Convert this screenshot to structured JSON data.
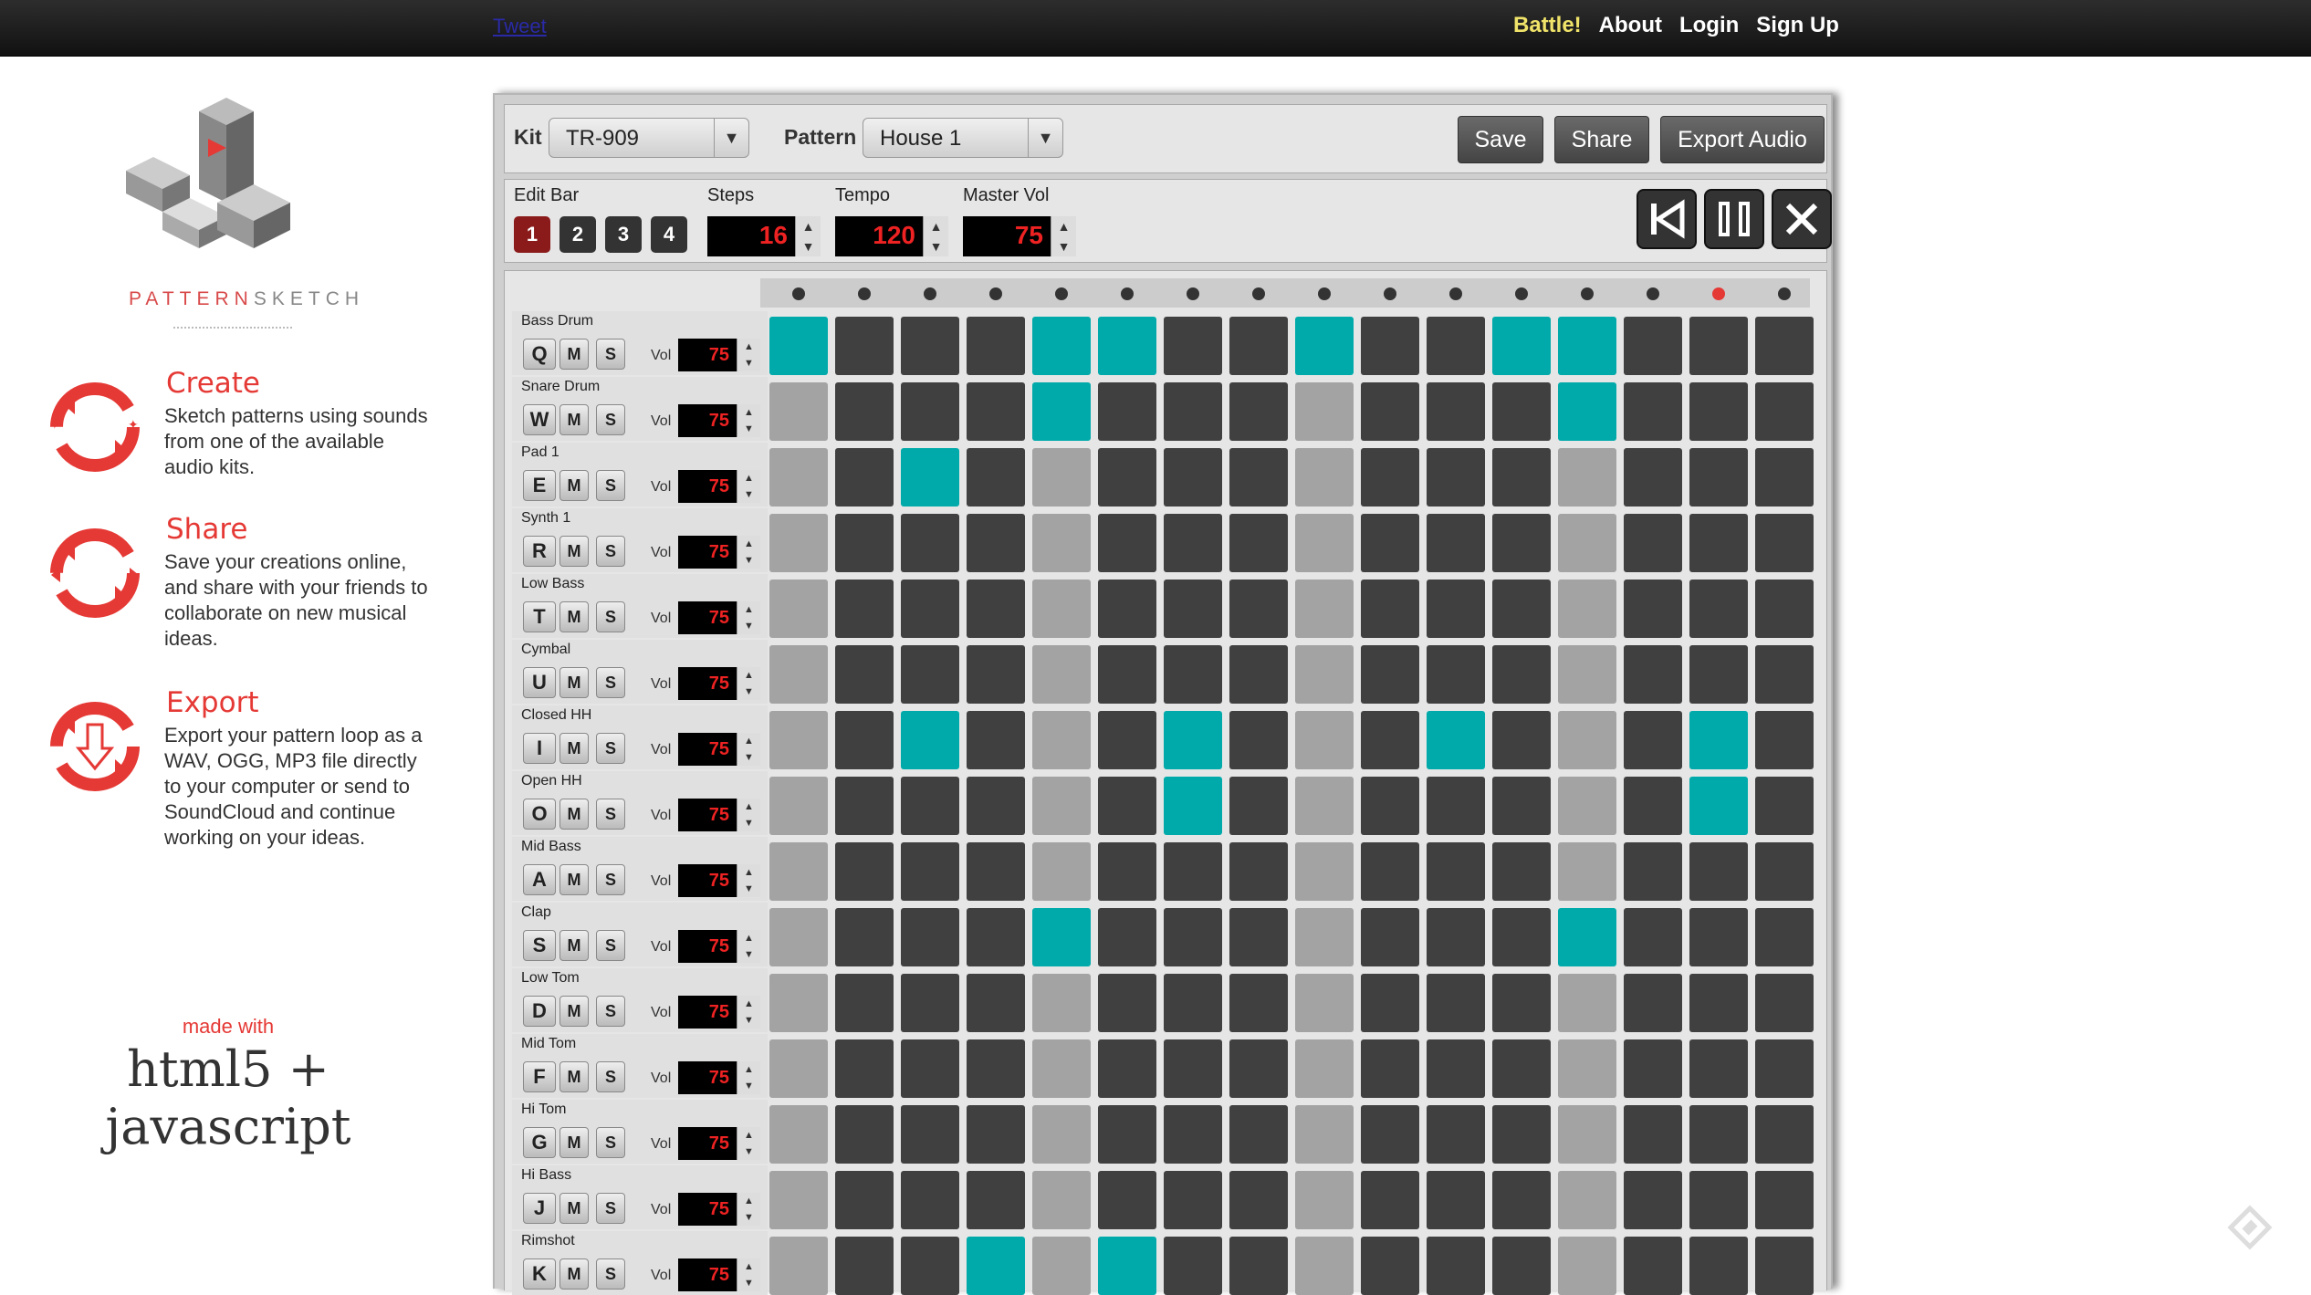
{
  "topbar": {
    "tweet": "Tweet",
    "nav": [
      {
        "label": "Battle!",
        "highlight": true
      },
      {
        "label": "About"
      },
      {
        "label": "Login"
      },
      {
        "label": "Sign Up"
      }
    ]
  },
  "brand": {
    "part1": "PATTERN",
    "part2": "SKETCH"
  },
  "features": [
    {
      "title": "Create",
      "text": "Sketch patterns using sounds from one of the available audio kits."
    },
    {
      "title": "Share",
      "text": "Save your creations online, and share with your friends to collaborate on new musical ideas."
    },
    {
      "title": "Export",
      "text": "Export your pattern loop as a WAV, OGG, MP3 file directly to your computer or send to SoundCloud and continue working on your ideas."
    }
  ],
  "made_with": {
    "label": "made with",
    "stack": "html5 + javascript"
  },
  "toolbar": {
    "kit_label": "Kit",
    "kit_value": "TR-909",
    "pattern_label": "Pattern",
    "pattern_value": "House 1",
    "save": "Save",
    "share": "Share",
    "export": "Export Audio"
  },
  "controls": {
    "edit_bar_label": "Edit Bar",
    "bars": [
      "1",
      "2",
      "3",
      "4"
    ],
    "active_bar": 0,
    "steps_label": "Steps",
    "steps": "16",
    "tempo_label": "Tempo",
    "tempo": "120",
    "master_vol_label": "Master Vol",
    "master_vol": "75"
  },
  "colors": {
    "active_cell": "#00aaaa",
    "accent": "#e53935",
    "led_text": "#ee2222"
  },
  "current_step": 14,
  "vol_label": "Vol",
  "tracks": [
    {
      "name": "Bass Drum",
      "key": "Q",
      "vol": "75",
      "steps": [
        1,
        0,
        0,
        0,
        1,
        1,
        0,
        0,
        1,
        0,
        0,
        1,
        1,
        0,
        0,
        0
      ]
    },
    {
      "name": "Snare Drum",
      "key": "W",
      "vol": "75",
      "steps": [
        0,
        0,
        0,
        0,
        1,
        0,
        0,
        0,
        0,
        0,
        0,
        0,
        1,
        0,
        0,
        0
      ]
    },
    {
      "name": "Pad 1",
      "key": "E",
      "vol": "75",
      "steps": [
        0,
        0,
        1,
        0,
        0,
        0,
        0,
        0,
        0,
        0,
        0,
        0,
        0,
        0,
        0,
        0
      ]
    },
    {
      "name": "Synth 1",
      "key": "R",
      "vol": "75",
      "steps": [
        0,
        0,
        0,
        0,
        0,
        0,
        0,
        0,
        0,
        0,
        0,
        0,
        0,
        0,
        0,
        0
      ]
    },
    {
      "name": "Low Bass",
      "key": "T",
      "vol": "75",
      "steps": [
        0,
        0,
        0,
        0,
        0,
        0,
        0,
        0,
        0,
        0,
        0,
        0,
        0,
        0,
        0,
        0
      ]
    },
    {
      "name": "Cymbal",
      "key": "U",
      "vol": "75",
      "steps": [
        0,
        0,
        0,
        0,
        0,
        0,
        0,
        0,
        0,
        0,
        0,
        0,
        0,
        0,
        0,
        0
      ]
    },
    {
      "name": "Closed HH",
      "key": "I",
      "vol": "75",
      "steps": [
        0,
        0,
        1,
        0,
        0,
        0,
        1,
        0,
        0,
        0,
        1,
        0,
        0,
        0,
        1,
        0
      ]
    },
    {
      "name": "Open HH",
      "key": "O",
      "vol": "75",
      "steps": [
        0,
        0,
        0,
        0,
        0,
        0,
        1,
        0,
        0,
        0,
        0,
        0,
        0,
        0,
        1,
        0
      ]
    },
    {
      "name": "Mid Bass",
      "key": "A",
      "vol": "75",
      "steps": [
        0,
        0,
        0,
        0,
        0,
        0,
        0,
        0,
        0,
        0,
        0,
        0,
        0,
        0,
        0,
        0
      ]
    },
    {
      "name": "Clap",
      "key": "S",
      "vol": "75",
      "steps": [
        0,
        0,
        0,
        0,
        1,
        0,
        0,
        0,
        0,
        0,
        0,
        0,
        1,
        0,
        0,
        0
      ]
    },
    {
      "name": "Low Tom",
      "key": "D",
      "vol": "75",
      "steps": [
        0,
        0,
        0,
        0,
        0,
        0,
        0,
        0,
        0,
        0,
        0,
        0,
        0,
        0,
        0,
        0
      ]
    },
    {
      "name": "Mid Tom",
      "key": "F",
      "vol": "75",
      "steps": [
        0,
        0,
        0,
        0,
        0,
        0,
        0,
        0,
        0,
        0,
        0,
        0,
        0,
        0,
        0,
        0
      ]
    },
    {
      "name": "Hi Tom",
      "key": "G",
      "vol": "75",
      "steps": [
        0,
        0,
        0,
        0,
        0,
        0,
        0,
        0,
        0,
        0,
        0,
        0,
        0,
        0,
        0,
        0
      ]
    },
    {
      "name": "Hi Bass",
      "key": "J",
      "vol": "75",
      "steps": [
        0,
        0,
        0,
        0,
        0,
        0,
        0,
        0,
        0,
        0,
        0,
        0,
        0,
        0,
        0,
        0
      ]
    },
    {
      "name": "Rimshot",
      "key": "K",
      "vol": "75",
      "steps": [
        0,
        0,
        0,
        1,
        0,
        1,
        0,
        0,
        0,
        0,
        0,
        0,
        0,
        0,
        0,
        0
      ]
    }
  ]
}
